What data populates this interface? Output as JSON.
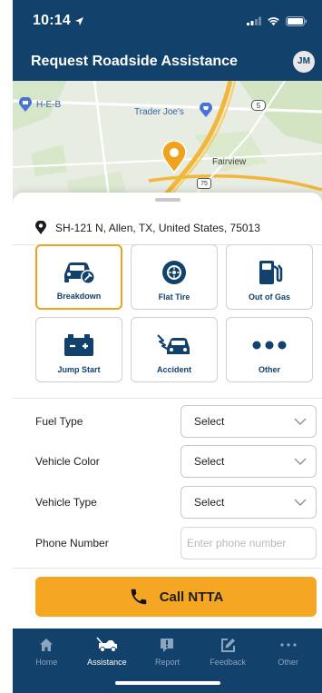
{
  "status_bar": {
    "time": "10:14"
  },
  "header": {
    "title": "Request Roadside Assistance",
    "avatar_initials": "JM"
  },
  "map": {
    "labels": {
      "heb": "H-E-B",
      "trader_joes": "Trader Joe's",
      "fairview": "Fairview",
      "route_5": "5",
      "route_75": "75"
    }
  },
  "location": {
    "address": "SH-121 N, Allen, TX, United States, 75013"
  },
  "services": [
    {
      "label": "Breakdown",
      "icon": "car-wrench-icon",
      "selected": true
    },
    {
      "label": "Flat Tire",
      "icon": "tire-icon",
      "selected": false
    },
    {
      "label": "Out of Gas",
      "icon": "fuel-pump-icon",
      "selected": false
    },
    {
      "label": "Jump Start",
      "icon": "battery-icon",
      "selected": false
    },
    {
      "label": "Accident",
      "icon": "car-crash-icon",
      "selected": false
    },
    {
      "label": "Other",
      "icon": "more-dots-icon",
      "selected": false
    }
  ],
  "form": {
    "fuel_type": {
      "label": "Fuel Type",
      "value": "Select"
    },
    "vehicle_color": {
      "label": "Vehicle Color",
      "value": "Select"
    },
    "vehicle_type": {
      "label": "Vehicle Type",
      "value": "Select"
    },
    "phone": {
      "label": "Phone Number",
      "placeholder": "Enter phone number",
      "value": ""
    }
  },
  "call_button": {
    "label": "Call NTTA"
  },
  "tabs": [
    {
      "label": "Home",
      "icon": "home-icon",
      "active": false
    },
    {
      "label": "Assistance",
      "icon": "tow-truck-icon",
      "active": true
    },
    {
      "label": "Report",
      "icon": "report-icon",
      "active": false
    },
    {
      "label": "Feedback",
      "icon": "edit-icon",
      "active": false
    },
    {
      "label": "Other",
      "icon": "more-icon",
      "active": false
    }
  ],
  "colors": {
    "brand_navy": "#12416b",
    "accent_orange": "#f5a623",
    "selected_border": "#f0a21a",
    "tab_inactive": "#8ea4bd"
  }
}
